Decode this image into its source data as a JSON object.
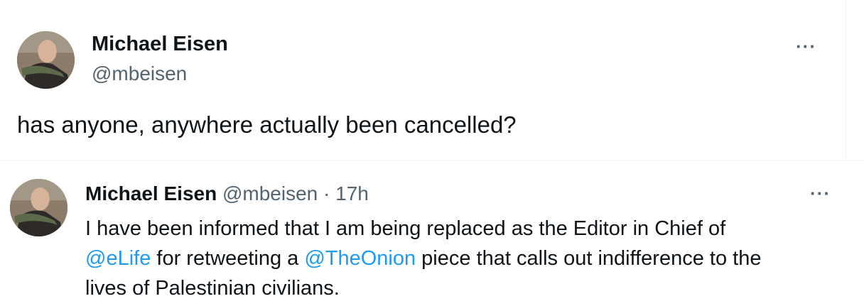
{
  "main_tweet": {
    "display_name": "Michael Eisen",
    "handle": "@mbeisen",
    "text": "has anyone, anywhere actually been cancelled?",
    "more_label": "···"
  },
  "quoted_tweet": {
    "display_name": "Michael Eisen",
    "handle": "@mbeisen",
    "separator": "·",
    "time": "17h",
    "more_label": "···",
    "text_part1": "I have been informed that I am being replaced as the Editor in Chief of",
    "mention1": "@eLife",
    "text_part2": " for retweeting a ",
    "mention2": "@TheOnion",
    "text_part3": " piece that calls out indifference to the",
    "text_part4": "lives of Palestinian civilians."
  },
  "colors": {
    "text": "#0f1419",
    "secondary": "#536471",
    "link": "#1d9bf0"
  },
  "icons": [
    "avatar",
    "more-options-icon"
  ]
}
